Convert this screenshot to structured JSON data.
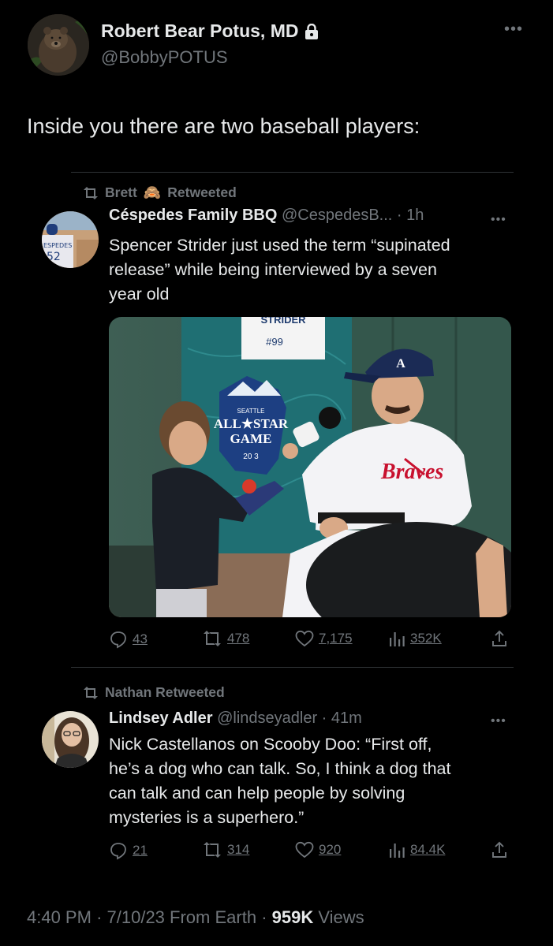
{
  "author": {
    "name": "Robert Bear Potus, MD",
    "handle": "@BobbyPOTUS",
    "avatar": "bear-avatar"
  },
  "tweet_text": "Inside you there are two baseball players:",
  "retweet1": {
    "retweeted_by": "Brett",
    "retweeted_by_emoji": "🙈",
    "retweeted_label": "Retweeted",
    "name": "Céspedes Family BBQ",
    "handle": "@CespedesB...",
    "time": "1h",
    "text_lines": [
      "Spencer Strider just used the term “supinated",
      "release” while being interviewed by a seven",
      "year old"
    ],
    "media": {
      "sign_top": "STRIDER",
      "sign_number": "#99",
      "logo_top": "SEATTLE",
      "logo_line1": "ALL★STAR",
      "logo_line2": "GAME",
      "logo_year": "20   3",
      "jersey": "Braves"
    },
    "stats": {
      "replies": "43",
      "retweets": "478",
      "likes": "7,175",
      "views": "352K"
    }
  },
  "retweet2": {
    "retweeted_label": "Nathan Retweeted",
    "name": "Lindsey Adler",
    "handle": "@lindseyadler",
    "time": "41m",
    "text_lines": [
      "Nick Castellanos on Scooby Doo: “First off,",
      "he’s a dog who can talk. So, I think a dog that",
      "can talk and can help people by solving",
      "mysteries is a superhero.”"
    ],
    "stats": {
      "replies": "21",
      "retweets": "314",
      "likes": "920",
      "views": "84.4K"
    }
  },
  "footer": {
    "time": "4:40 PM",
    "date": "7/10/23",
    "source": "From Earth",
    "views_count": "959K",
    "views_label": "Views"
  },
  "colors": {
    "background": "#000000",
    "text": "#e7e9ea",
    "secondary": "#71767b",
    "divider": "#2f3336"
  }
}
